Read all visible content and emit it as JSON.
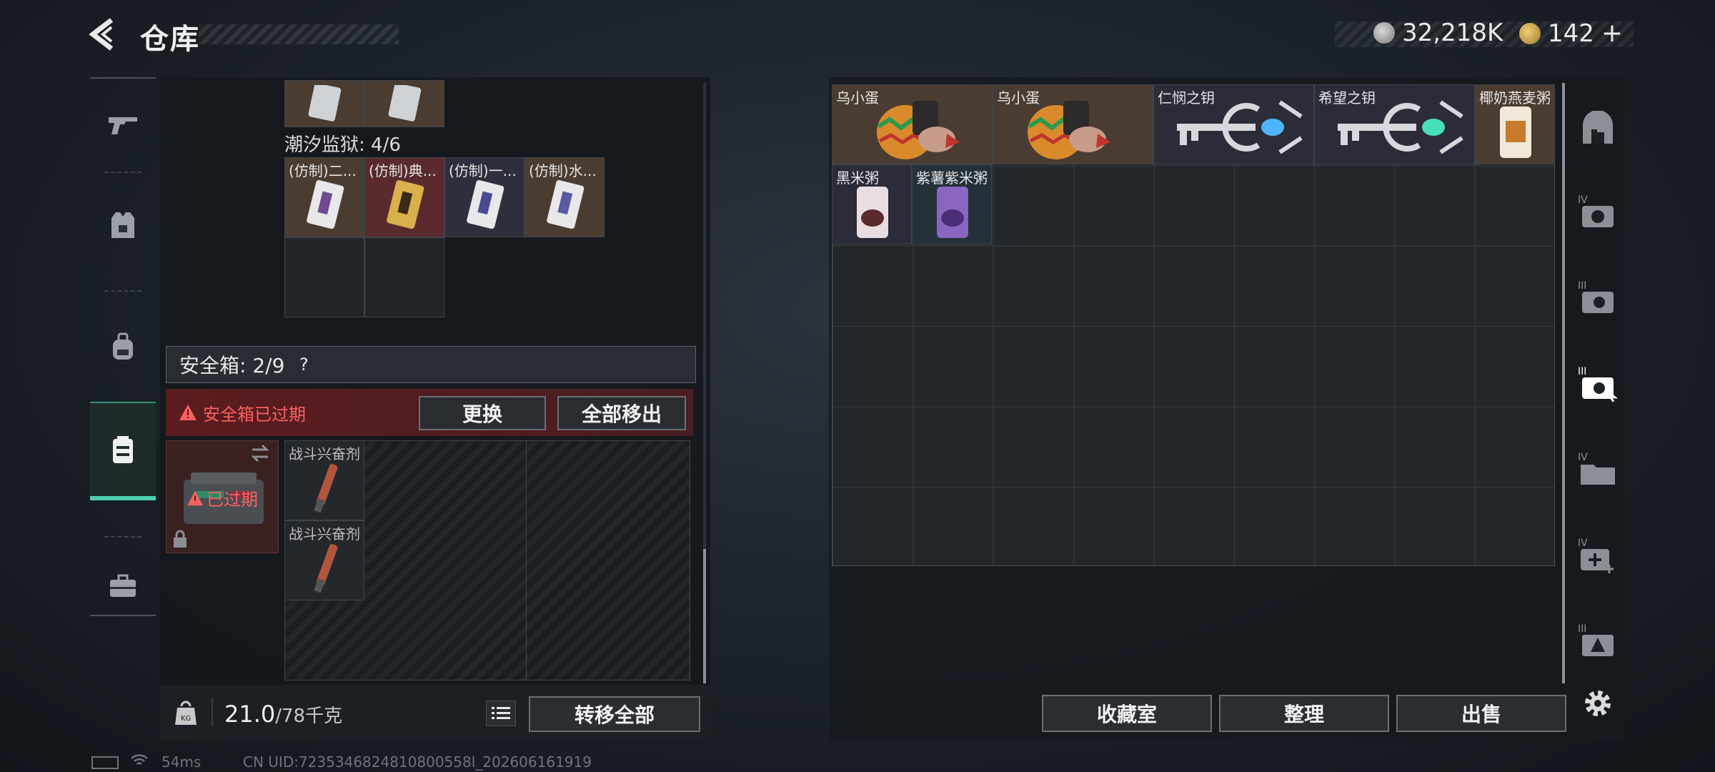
{
  "header": {
    "title": "仓库",
    "currencies": [
      {
        "icon": "silver-coin-icon",
        "value": "32,218K"
      },
      {
        "icon": "gold-coin-icon",
        "value": "142"
      }
    ],
    "plus_label": "+"
  },
  "left_nav": {
    "items": [
      {
        "icon": "gun-icon"
      },
      {
        "icon": "armor-vest-icon"
      },
      {
        "icon": "backpack-icon"
      },
      {
        "icon": "safebox-icon",
        "active": true
      },
      {
        "icon": "toolbox-icon"
      }
    ]
  },
  "container": {
    "top_items": [
      {
        "name": ""
      },
      {
        "name": ""
      }
    ],
    "section_label": "潮汐监狱: 4/6",
    "section_items": [
      {
        "name": "(仿制)二...",
        "tint": "#4a3c30"
      },
      {
        "name": "(仿制)典...",
        "tint": "#5a2a2e"
      },
      {
        "name": "(仿制)一...",
        "tint": "#2e2f3c"
      },
      {
        "name": "(仿制)水...",
        "tint": "#4a3c30"
      }
    ]
  },
  "safebox": {
    "label": "安全箱: 2/9",
    "help": "?",
    "expired_warning": "安全箱已过期",
    "replace_button": "更换",
    "remove_all_button": "全部移出",
    "case_status": "已过期",
    "items": [
      {
        "name": "战斗兴奋剂"
      },
      {
        "name": "战斗兴奋剂"
      }
    ]
  },
  "weight": {
    "current": "21.0",
    "max": "/78千克",
    "transfer_all_button": "转移全部"
  },
  "stash": {
    "items": [
      {
        "name": "乌小蛋",
        "kind": "egg",
        "tint": "#4a3c30"
      },
      {
        "name": "乌小蛋",
        "kind": "egg",
        "tint": "#4a3c30"
      },
      {
        "name": "仁悯之钥",
        "kind": "key",
        "gem": "#4fb4ff",
        "tint": "#2b2c38"
      },
      {
        "name": "希望之钥",
        "kind": "key",
        "gem": "#46e0b8",
        "tint": "#2b2c38"
      },
      {
        "name": "椰奶燕麦粥",
        "kind": "food",
        "tint": "#4a3c30"
      },
      {
        "name": "黑米粥",
        "kind": "food",
        "tint": "#2b2c38"
      },
      {
        "name": "紫薯紫米粥",
        "kind": "food",
        "tint": "#24303a"
      }
    ],
    "buttons": {
      "collection": "收藏室",
      "sort": "整理",
      "sell": "出售"
    }
  },
  "right_nav": {
    "items": [
      {
        "icon": "vault-home-icon"
      },
      {
        "icon": "cabinet-iv-icon",
        "tier": "IV"
      },
      {
        "icon": "cabinet-iii-icon",
        "tier": "III"
      },
      {
        "icon": "cabinet-iii-active-icon",
        "tier": "III",
        "active": true
      },
      {
        "icon": "folder-iv-icon",
        "tier": "IV"
      },
      {
        "icon": "medkit-iv-icon",
        "tier": "IV"
      },
      {
        "icon": "warning-box-iii-icon",
        "tier": "III"
      }
    ],
    "settings_icon": "gear-icon"
  },
  "status_bar": {
    "ping": "54ms",
    "uid": "CN UID:7235346824810800558l_202606161919"
  }
}
